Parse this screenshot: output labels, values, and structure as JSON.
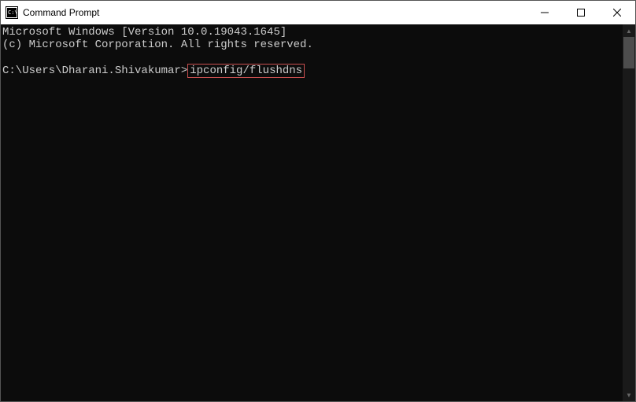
{
  "titlebar": {
    "title": "Command Prompt"
  },
  "console": {
    "line1": "Microsoft Windows [Version 10.0.19043.1645]",
    "line2": "(c) Microsoft Corporation. All rights reserved.",
    "prompt": "C:\\Users\\Dharani.Shivakumar>",
    "command": "ipconfig/flushdns"
  },
  "icons": {
    "minimize": "—",
    "maximize": "☐",
    "close": "✕",
    "up": "▲",
    "down": "▼"
  }
}
